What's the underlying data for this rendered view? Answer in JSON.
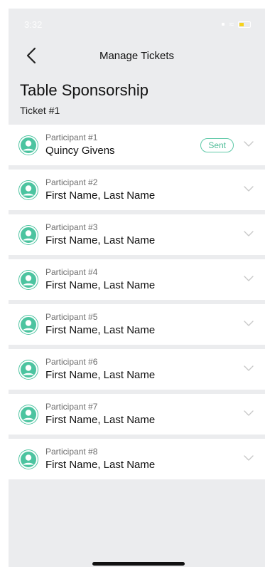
{
  "status": {
    "time": "3:32"
  },
  "nav": {
    "title": "Manage Tickets"
  },
  "header": {
    "title": "Table Sponsorship",
    "subtitle": "Ticket #1"
  },
  "participants": [
    {
      "label": "Participant #1",
      "name": "Quincy Givens",
      "badge": "Sent"
    },
    {
      "label": "Participant #2",
      "name": "First Name, Last Name"
    },
    {
      "label": "Participant #3",
      "name": "First Name, Last Name"
    },
    {
      "label": "Participant #4",
      "name": "First Name, Last Name"
    },
    {
      "label": "Participant #5",
      "name": "First Name, Last Name"
    },
    {
      "label": "Participant #6",
      "name": "First Name, Last Name"
    },
    {
      "label": "Participant #7",
      "name": "First Name, Last Name"
    },
    {
      "label": "Participant #8",
      "name": "First Name, Last Name"
    }
  ],
  "colors": {
    "accent": "#4cc4a0",
    "background": "#ebecee",
    "battery": "#f6d21c"
  }
}
